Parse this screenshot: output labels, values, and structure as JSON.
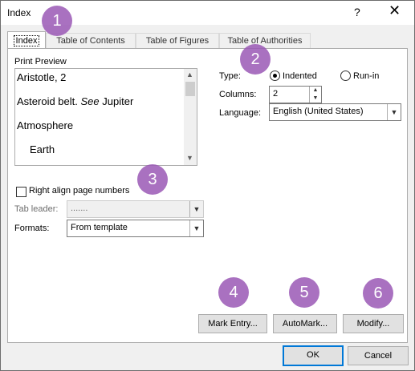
{
  "window": {
    "title": "Index",
    "help_label": "?",
    "close_label": "✕"
  },
  "tabs": [
    {
      "label": "Index",
      "active": true
    },
    {
      "label": "Table of Contents",
      "active": false
    },
    {
      "label": "Table of Figures",
      "active": false
    },
    {
      "label": "Table of Authorities",
      "active": false
    }
  ],
  "print_preview": {
    "label": "Print Preview",
    "lines": [
      "Aristotle, 2",
      "Asteroid belt. ",
      "See",
      " Jupiter",
      "Atmosphere",
      "Earth"
    ]
  },
  "right_align": {
    "label": "Right align page numbers",
    "checked": false
  },
  "tab_leader": {
    "label": "Tab leader:",
    "value": "......."
  },
  "formats": {
    "label": "Formats:",
    "value": "From template"
  },
  "type": {
    "label": "Type:",
    "options": [
      {
        "label": "Indented",
        "checked": true
      },
      {
        "label": "Run-in",
        "checked": false
      }
    ]
  },
  "columns": {
    "label": "Columns:",
    "value": "2"
  },
  "language": {
    "label": "Language:",
    "value": "English (United States)"
  },
  "buttons": {
    "mark_entry": "Mark Entry...",
    "automark": "AutoMark...",
    "modify": "Modify...",
    "ok": "OK",
    "cancel": "Cancel"
  },
  "badges": [
    "1",
    "2",
    "3",
    "4",
    "5",
    "6"
  ],
  "colors": {
    "badge": "#9b59b6",
    "default_button_border": "#0078d7"
  }
}
